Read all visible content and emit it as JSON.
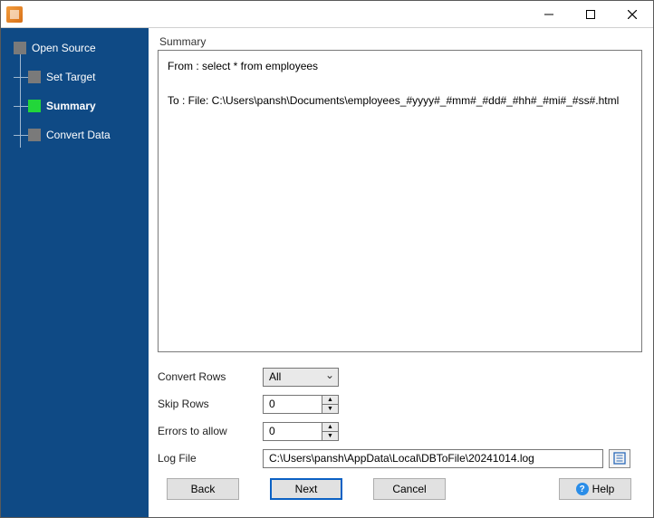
{
  "titlebar": {
    "title": ""
  },
  "nav": {
    "items": [
      {
        "label": "Open Source"
      },
      {
        "label": "Set Target"
      },
      {
        "label": "Summary"
      },
      {
        "label": "Convert Data"
      }
    ]
  },
  "main": {
    "section_label": "Summary",
    "summary_text": "From : select * from employees\n\nTo : File: C:\\Users\\pansh\\Documents\\employees_#yyyy#_#mm#_#dd#_#hh#_#mi#_#ss#.html"
  },
  "fields": {
    "convert_rows": {
      "label": "Convert Rows",
      "value": "All"
    },
    "skip_rows": {
      "label": "Skip Rows",
      "value": "0"
    },
    "errors": {
      "label": "Errors to allow",
      "value": "0"
    },
    "log_file": {
      "label": "Log File",
      "value": "C:\\Users\\pansh\\AppData\\Local\\DBToFile\\20241014.log"
    }
  },
  "buttons": {
    "back": "Back",
    "next": "Next",
    "cancel": "Cancel",
    "help": "Help"
  }
}
